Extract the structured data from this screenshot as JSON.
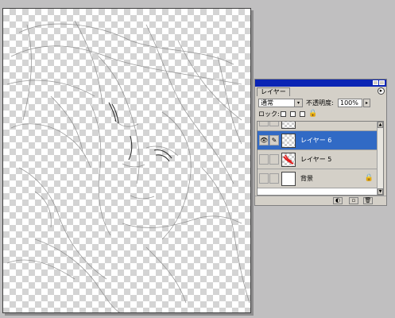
{
  "layers_palette": {
    "tab_label": "レイヤー",
    "menu_button": "▸",
    "blend_mode": "通常",
    "opacity_label": "不透明度:",
    "opacity_value": "100%",
    "lock_label": "ロック:",
    "layers": [
      {
        "name": "",
        "visible": false,
        "thumbnail": "transparent"
      },
      {
        "name": "レイヤー 6",
        "visible": true,
        "selected": true,
        "thumbnail": "transparent"
      },
      {
        "name": "レイヤー 5",
        "visible": false,
        "thumbnail": "red-sketch"
      },
      {
        "name": "背景",
        "visible": false,
        "thumbnail": "white",
        "locked": true
      }
    ],
    "bottom_buttons": [
      "adjustment-layer-icon",
      "new-layer-icon",
      "trash-icon"
    ]
  },
  "colors": {
    "title_bar": "#0a24b4",
    "selected_row": "#316ac5",
    "workspace": "#c0bfc0"
  }
}
